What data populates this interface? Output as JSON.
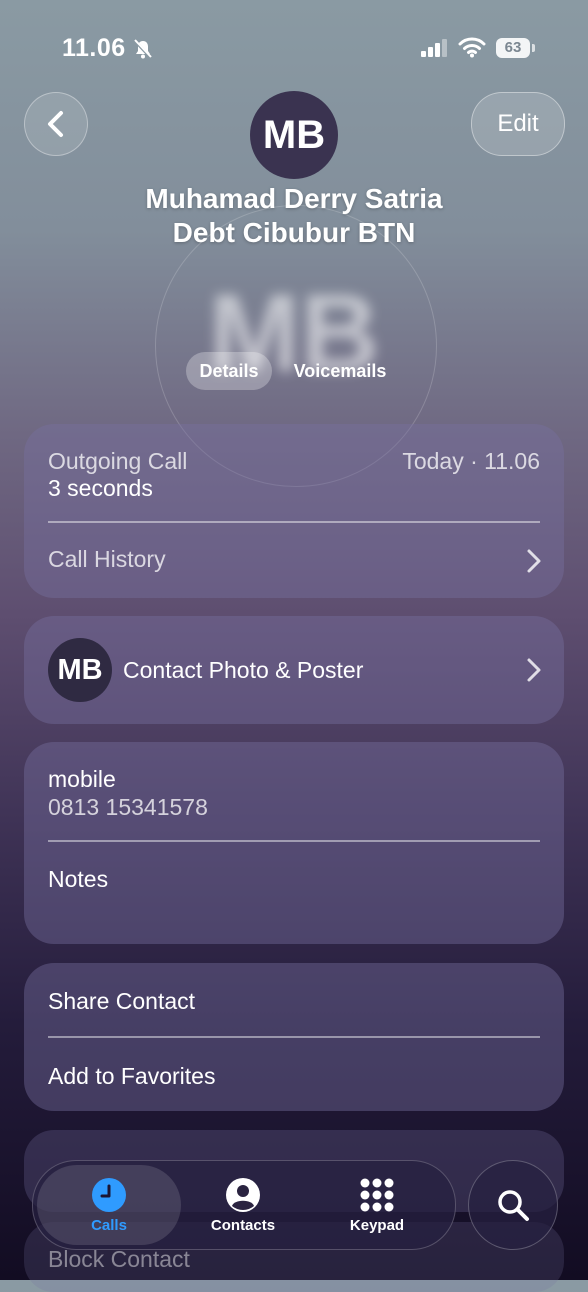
{
  "status_bar": {
    "time": "11.06",
    "battery": "63"
  },
  "header": {
    "edit_label": "Edit",
    "avatar_initials": "MB",
    "name_line1": "Muhamad Derry Satria",
    "name_line2": "Debt Cibubur BTN"
  },
  "tabs": {
    "details": "Details",
    "voicemails": "Voicemails"
  },
  "recent_call": {
    "type": "Outgoing Call",
    "duration": "3 seconds",
    "time": "Today · 11.06",
    "history_label": "Call History"
  },
  "poster": {
    "initials": "MB",
    "label": "Contact Photo & Poster"
  },
  "phone": {
    "label": "mobile",
    "number": "0813 15341578",
    "notes_label": "Notes"
  },
  "actions": {
    "share": "Share Contact",
    "favorites": "Add to Favorites",
    "block": "Block Contact"
  },
  "tabbar": {
    "calls": "Calls",
    "contacts": "Contacts",
    "keypad": "Keypad"
  },
  "colors": {
    "accent": "#2f9bff"
  }
}
